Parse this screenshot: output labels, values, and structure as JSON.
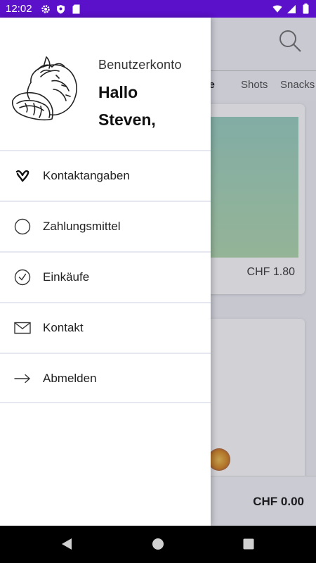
{
  "status_bar": {
    "time": "12:02",
    "background": "#5b10c9",
    "icons": [
      "settings-icon",
      "shield-icon",
      "sd-card-icon",
      "wifi-icon",
      "signal-icon",
      "battery-icon"
    ]
  },
  "background_app": {
    "tabs": [
      "nke",
      "Shots",
      "Snacks"
    ],
    "card_price": "CHF 1.80",
    "total": "CHF 0.00"
  },
  "drawer": {
    "account_label": "Benutzerkonto",
    "greeting_line1": "Hallo",
    "greeting_line2": "Steven,",
    "items": [
      {
        "label": "Kontaktangaben",
        "icon": "heart-v-icon"
      },
      {
        "label": "Zahlungsmittel",
        "icon": "circle-icon"
      },
      {
        "label": "Einkäufe",
        "icon": "check-circle-icon"
      },
      {
        "label": "Kontakt",
        "icon": "envelope-icon"
      },
      {
        "label": "Abmelden",
        "icon": "arrow-right-icon"
      }
    ]
  },
  "nav_bar": {
    "buttons": [
      "back-icon",
      "home-icon",
      "recents-icon"
    ]
  }
}
